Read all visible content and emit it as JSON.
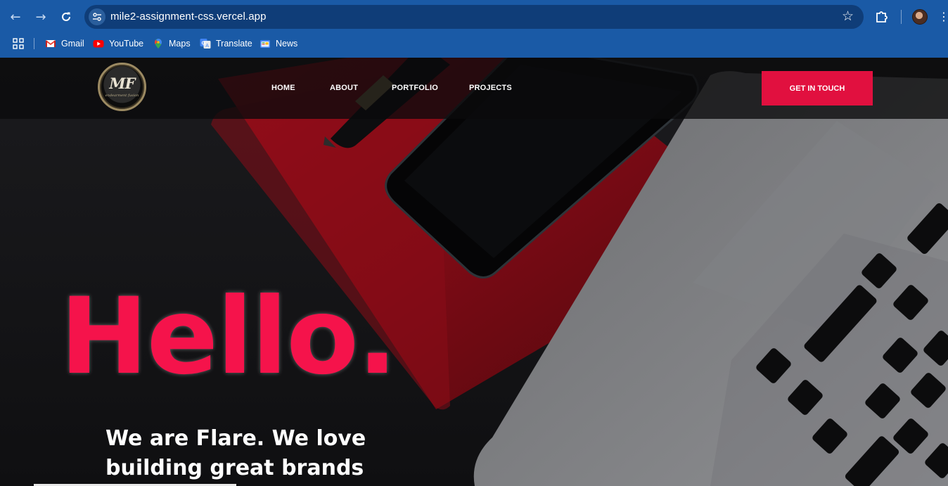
{
  "browser": {
    "url": "mile2-assignment-css.vercel.app",
    "bookmarks": [
      {
        "label": "Gmail",
        "icon": "gmail-icon"
      },
      {
        "label": "YouTube",
        "icon": "youtube-icon"
      },
      {
        "label": "Maps",
        "icon": "maps-icon"
      },
      {
        "label": "Translate",
        "icon": "translate-icon"
      },
      {
        "label": "News",
        "icon": "news-icon"
      }
    ]
  },
  "site": {
    "logo": {
      "mark": "MF",
      "tagline": "endearment fusion"
    },
    "nav": [
      "HOME",
      "ABOUT",
      "PORTFOLIO",
      "PROJECTS"
    ],
    "cta_label": "GET IN TOUCH",
    "hero": {
      "headline": "Hello.",
      "tagline": "We are Flare. We love building great brands"
    },
    "colors": {
      "accent": "#e1103f",
      "headline": "#f5134b",
      "chrome": "#1a5aa6"
    }
  }
}
